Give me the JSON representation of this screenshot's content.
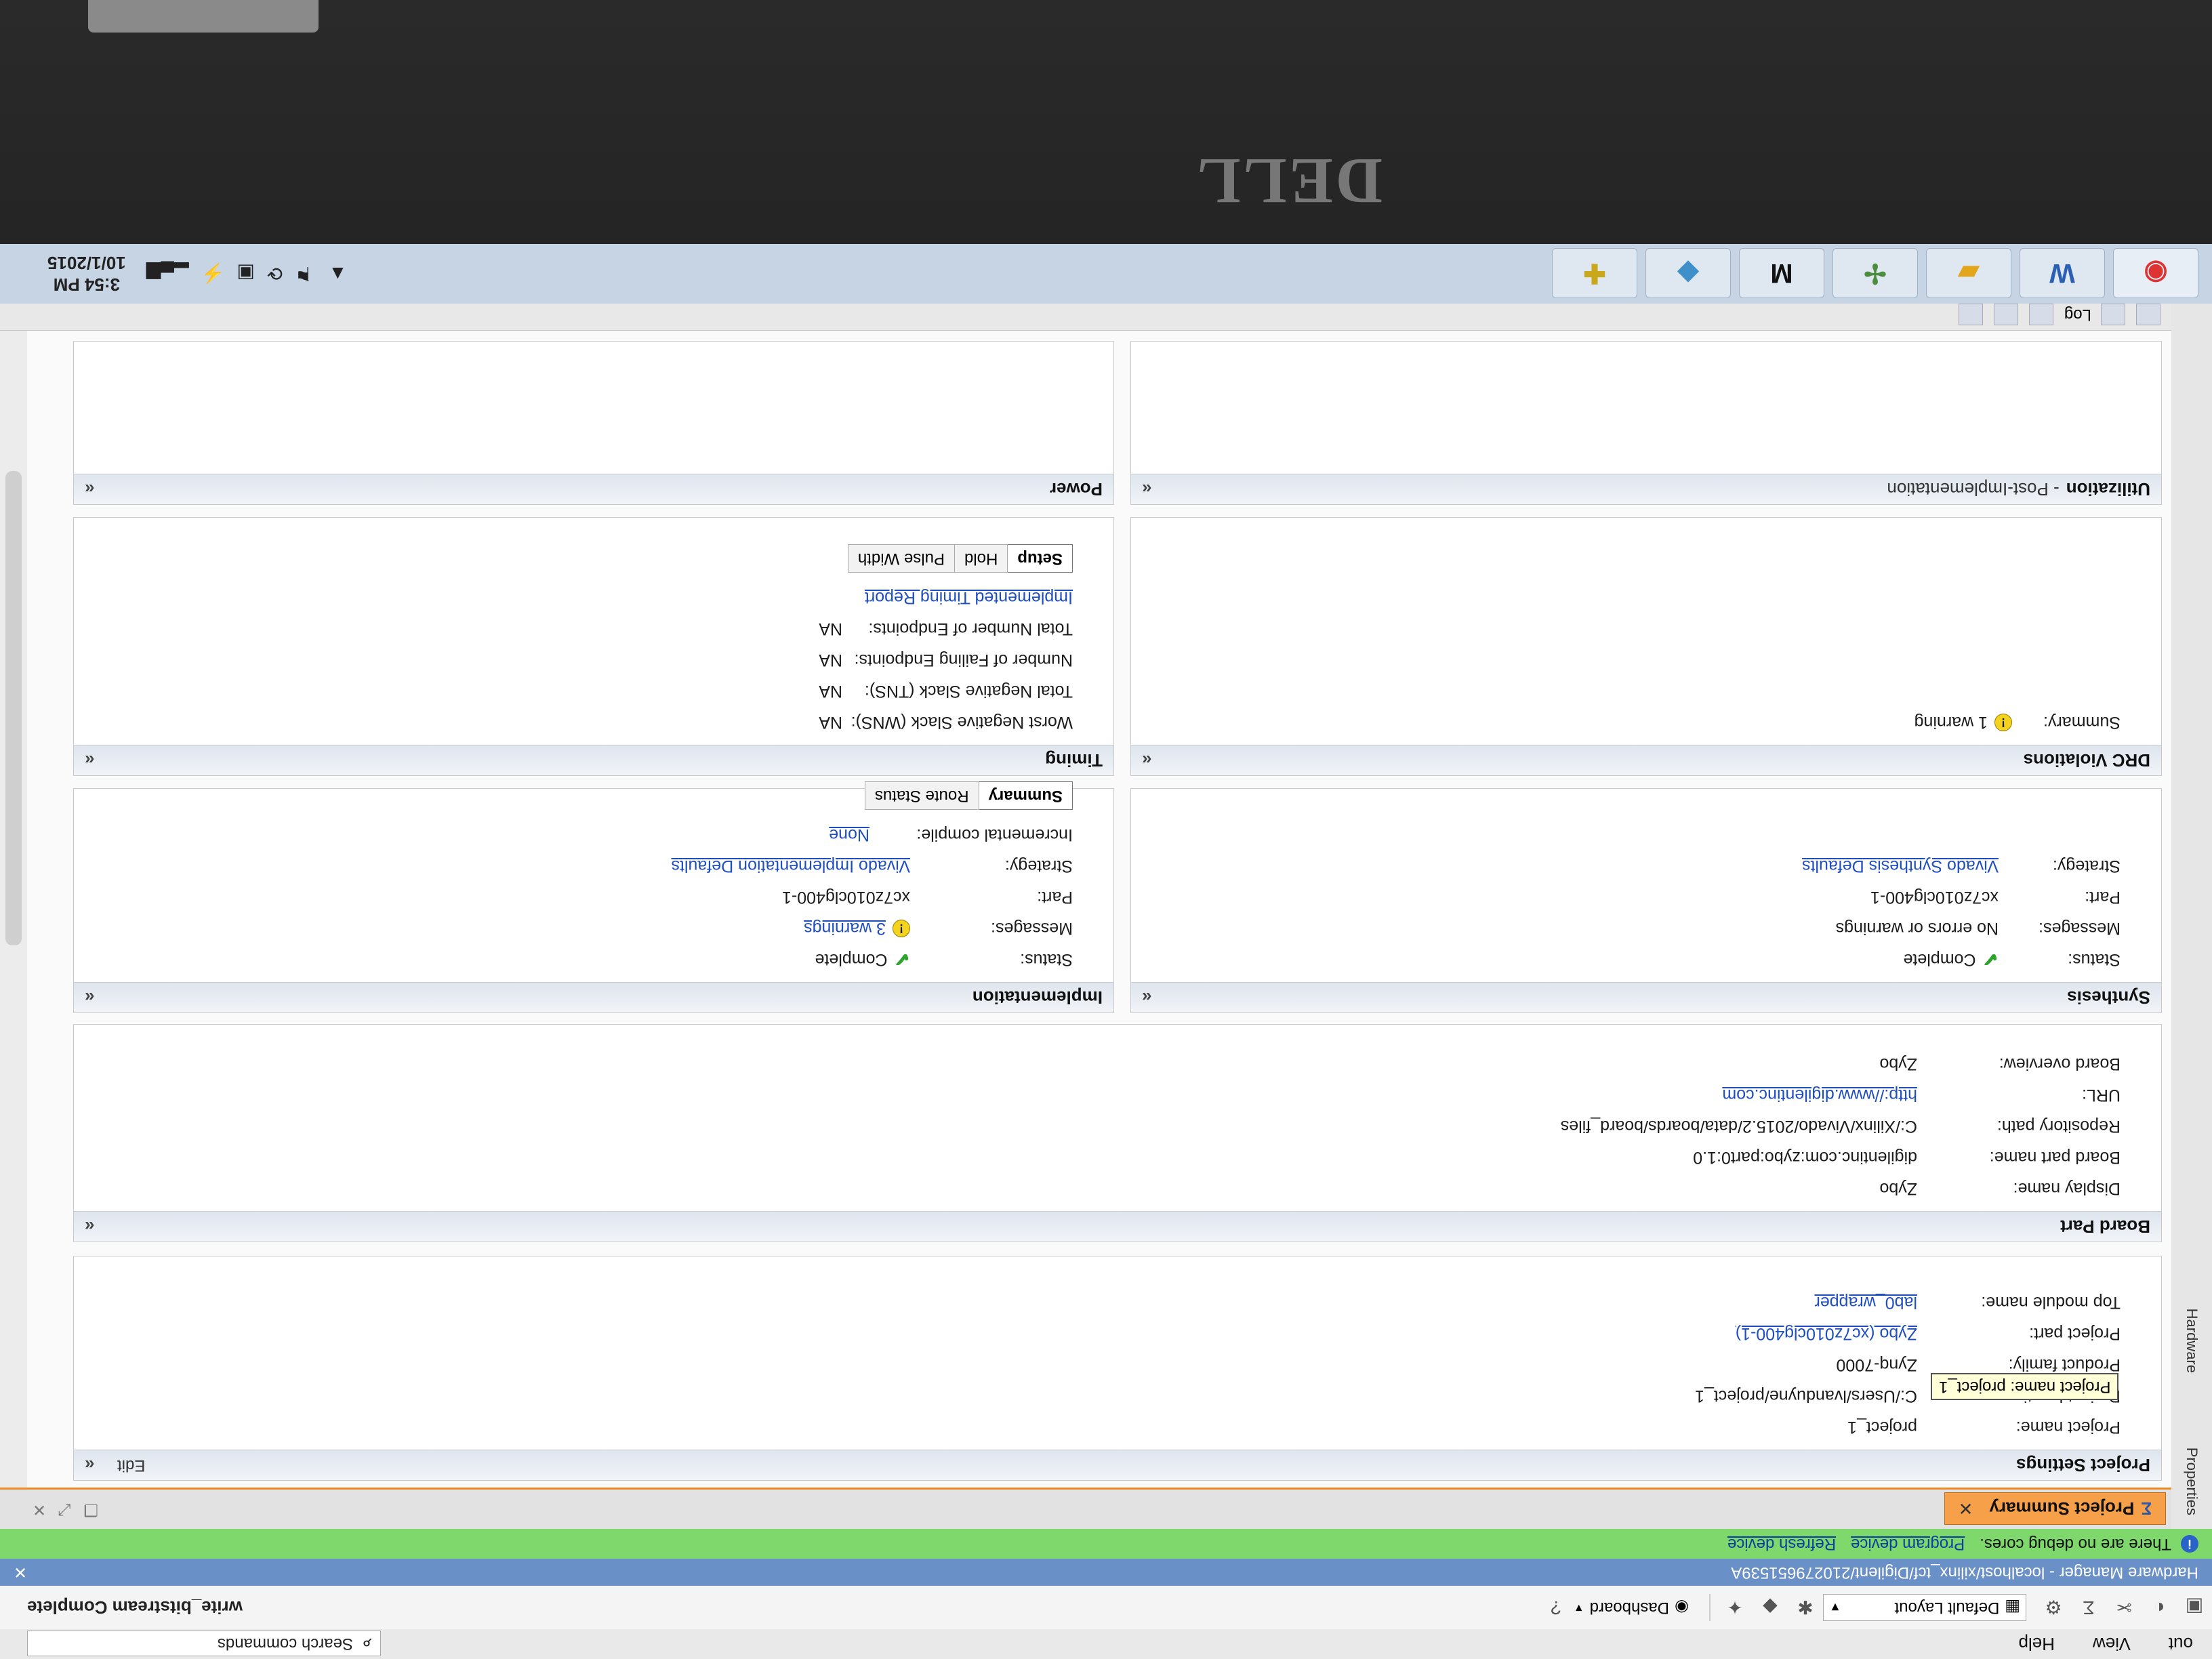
{
  "brand": {
    "logo_text": "DELL"
  },
  "menubar": {
    "items": [
      "out",
      "View",
      "Help"
    ],
    "search_placeholder": "Search commands"
  },
  "toolbar": {
    "layout_value": "Default Layout",
    "dashboard_label": "Dashboard",
    "status": "write_bitstream Complete"
  },
  "hw_manager": {
    "title": "Hardware Manager - localhost/xilinx_tcf/Digilent/210279651539A"
  },
  "debug_banner": {
    "text": "There are no debug cores.",
    "program_link": "Program device",
    "refresh_link": "Refresh device"
  },
  "side_tabs": [
    "Properties",
    "Hardware"
  ],
  "summary_tab": {
    "label": "Project Summary"
  },
  "project_settings": {
    "title": "Project Settings",
    "edit_label": "Edit",
    "rows": [
      {
        "label": "Project name:",
        "value": "project_1"
      },
      {
        "label": "Project location:",
        "value": "C:/Users/lvanduyne/project_1"
      },
      {
        "label": "Product family:",
        "value": "Zynq-7000"
      },
      {
        "label": "Project part:",
        "value": "Zybo (xc7z010clg400-1)"
      },
      {
        "label": "Top module name:",
        "value": "lab0_wrapper"
      }
    ],
    "tooltip": "Project name: project_1"
  },
  "board_part": {
    "title": "Board Part",
    "rows": [
      {
        "label": "Display name:",
        "value": "Zybo"
      },
      {
        "label": "Board part name:",
        "value": "digilentinc.com:zybo:part0:1.0"
      },
      {
        "label": "Repository path:",
        "value": "C:/Xilinx/Vivado/2015.2/data/boards/board_files"
      },
      {
        "label": "URL:",
        "value": "http://www.digilentinc.com"
      },
      {
        "label": "Board overview:",
        "value": "Zybo"
      }
    ]
  },
  "synthesis": {
    "title": "Synthesis",
    "status_label": "Status:",
    "status": "Complete",
    "messages_label": "Messages:",
    "messages": "No errors or warnings",
    "part_label": "Part:",
    "part": "xc7z010clg400-1",
    "strategy_label": "Strategy:",
    "strategy": "Vivado Synthesis Defaults"
  },
  "implementation": {
    "title": "Implementation",
    "status_label": "Status:",
    "status": "Complete",
    "messages_label": "Messages:",
    "messages": "3 warnings",
    "part_label": "Part:",
    "part": "xc7z010clg400-1",
    "strategy_label": "Strategy:",
    "strategy": "Vivado Implementation Defaults",
    "incremental_label": "Incremental compile:",
    "incremental": "None",
    "buttons": [
      "Summary",
      "Route Status"
    ]
  },
  "drc": {
    "title": "DRC Violations",
    "summary_label": "Summary:",
    "summary": "1 warning"
  },
  "timing": {
    "title": "Timing",
    "rows": [
      {
        "label": "Worst Negative Slack (WNS):",
        "value": "NA"
      },
      {
        "label": "Total Negative Slack (TNS):",
        "value": "NA"
      },
      {
        "label": "Number of Failing Endpoints:",
        "value": "NA"
      },
      {
        "label": "Total Number of Endpoints:",
        "value": "NA"
      }
    ],
    "report_link": "Implemented Timing Report",
    "buttons": [
      "Setup",
      "Hold",
      "Pulse Width"
    ]
  },
  "utilization": {
    "title": "Utilization",
    "subtitle": "- Post-Implementation"
  },
  "power": {
    "title": "Power"
  },
  "log_bar": {
    "label": "Log"
  },
  "taskbar": {
    "apps": [
      "chrome",
      "W",
      "folder",
      "vivado",
      "M",
      "3d",
      "app"
    ],
    "time": "3:54 PM",
    "date": "10/1/2015"
  }
}
